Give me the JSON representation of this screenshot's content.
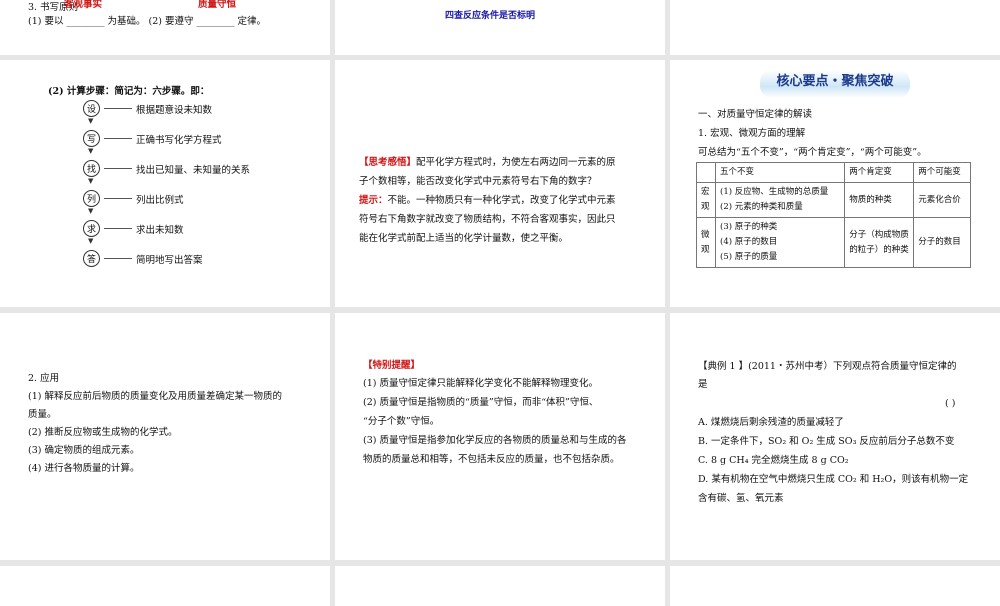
{
  "slide1": {
    "heading": "3. 书写原则",
    "answer1": "客观事实",
    "answer2": "质量守恒",
    "line": "(1) 要以 ________ 为基础。 (2) 要遵守 ________ 定律。"
  },
  "slide2": {
    "text": "四查反应条件是否标明"
  },
  "slide4": {
    "heading": "(2) 计算步骤：简记为：六步骤。即：",
    "steps": [
      {
        "char": "设",
        "text": "根据题意设未知数"
      },
      {
        "char": "写",
        "text": "正确书写化学方程式"
      },
      {
        "char": "找",
        "text": "找出已知量、未知量的关系"
      },
      {
        "char": "列",
        "text": "列出比例式"
      },
      {
        "char": "求",
        "text": "求出未知数"
      },
      {
        "char": "答",
        "text": "简明地写出答案"
      }
    ]
  },
  "slide5": {
    "label": "【思考感悟】",
    "q1": "配平化学方程式时，为使左右两边同一元素的原",
    "q2": "子个数相等，能否改变化学式中元素符号右下角的数字？",
    "hint_label": "提示：",
    "a1": "不能。一种物质只有一种化学式，改变了化学式中元素",
    "a2": "符号右下角数字就改变了物质结构，不符合客观事实，因此只",
    "a3": "能在化学式前配上适当的化学计量数，使之平衡。"
  },
  "slide6": {
    "banner": "核心要点・聚焦突破",
    "h1": "一、对质量守恒定律的解读",
    "h2": "1. 宏观、微观方面的理解",
    "summary": "可总结为“五个不变”，“两个肯定变”，“两个可能变”。",
    "table": {
      "headers": [
        "",
        "五个不变",
        "两个肯定变",
        "两个可能变"
      ],
      "macro": {
        "label": "宏观",
        "unchanged": [
          "(1) 反应物、生成物的总质量",
          "(2) 元素的种类和质量"
        ],
        "must": "物质的种类",
        "may": "元素化合价"
      },
      "micro": {
        "label": "微观",
        "unchanged": [
          "(3) 原子的种类",
          "(4) 原子的数目",
          "(5) 原子的质量"
        ],
        "must": "分子（构成物质的粒子）的种类",
        "may": "分子的数目"
      }
    }
  },
  "slide7": {
    "lines": [
      "2. 应用",
      "(1) 解释反应前后物质的质量变化及用质量差确定某一物质的",
      "质量。",
      "(2) 推断反应物或生成物的化学式。",
      "(3) 确定物质的组成元素。",
      "(4) 进行各物质量的计算。"
    ]
  },
  "slide8": {
    "label": "【特别提醒】",
    "lines": [
      "(1) 质量守恒定律只能解释化学变化不能解释物理变化。",
      "(2) 质量守恒是指物质的“质量”守恒，而非“体积”守恒、",
      "“分子个数”守恒。",
      "(3) 质量守恒是指参加化学反应的各物质的质量总和与生成的各",
      "物质的质量总和相等，不包括未反应的质量，也不包括杂质。"
    ]
  },
  "slide9": {
    "q1": "【典例 1 】(2011・苏州中考）下列观点符合质量守恒定律的",
    "q2": "是",
    "blank": "(    )",
    "options": [
      "A. 煤燃烧后剩余残渣的质量减轻了",
      "B. 一定条件下，SO₂ 和 O₂ 生成 SO₃ 反应前后分子总数不变",
      "C. 8 g CH₄ 完全燃烧生成 8 g CO₂",
      "D. 某有机物在空气中燃烧只生成 CO₂ 和 H₂O，则该有机物一定",
      "含有碳、氢、氧元素"
    ]
  }
}
